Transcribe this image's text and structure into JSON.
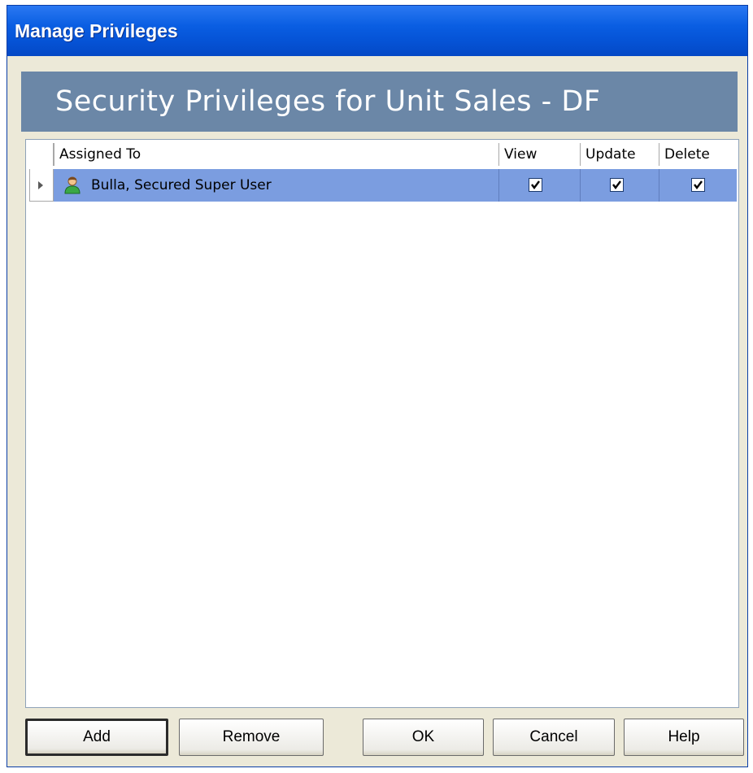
{
  "window": {
    "title": "Manage Privileges"
  },
  "banner": {
    "text": "Security Privileges for Unit Sales - DF"
  },
  "grid": {
    "columns": [
      "Assigned To",
      "View",
      "Update",
      "Delete"
    ],
    "rows": [
      {
        "assigned_to": "Bulla, Secured Super User",
        "icon": "user-icon",
        "view": true,
        "update": true,
        "delete": true
      }
    ]
  },
  "buttons": {
    "add": "Add",
    "remove": "Remove",
    "ok": "OK",
    "cancel": "Cancel",
    "help": "Help"
  }
}
